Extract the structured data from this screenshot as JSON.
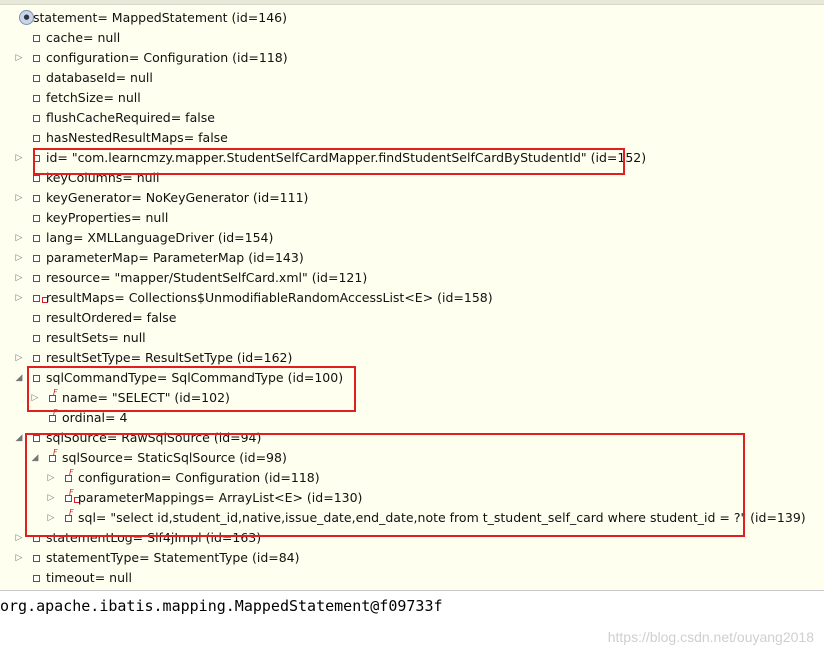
{
  "variables": [
    {
      "label": "statement= MappedStatement  (id=146)",
      "depth": 0,
      "twisty": "none",
      "icon": "gear-icon"
    },
    {
      "label": "cache= null",
      "depth": 1,
      "twisty": "none",
      "icon": "field-icon"
    },
    {
      "label": "configuration= Configuration  (id=118)",
      "depth": 1,
      "twisty": "collapsed",
      "icon": "field-icon"
    },
    {
      "label": "databaseId= null",
      "depth": 1,
      "twisty": "none",
      "icon": "field-icon"
    },
    {
      "label": "fetchSize= null",
      "depth": 1,
      "twisty": "none",
      "icon": "field-icon"
    },
    {
      "label": "flushCacheRequired= false",
      "depth": 1,
      "twisty": "none",
      "icon": "field-icon"
    },
    {
      "label": "hasNestedResultMaps= false",
      "depth": 1,
      "twisty": "none",
      "icon": "field-icon"
    },
    {
      "label": "id= \"com.learncmzy.mapper.StudentSelfCardMapper.findStudentSelfCardByStudentId\" (id=152)",
      "depth": 1,
      "twisty": "collapsed",
      "icon": "field-icon"
    },
    {
      "label": "keyColumns= null",
      "depth": 1,
      "twisty": "none",
      "icon": "field-icon"
    },
    {
      "label": "keyGenerator= NoKeyGenerator  (id=111)",
      "depth": 1,
      "twisty": "collapsed",
      "icon": "field-icon"
    },
    {
      "label": "keyProperties= null",
      "depth": 1,
      "twisty": "none",
      "icon": "field-icon"
    },
    {
      "label": "lang= XMLLanguageDriver  (id=154)",
      "depth": 1,
      "twisty": "collapsed",
      "icon": "field-icon"
    },
    {
      "label": "parameterMap= ParameterMap  (id=143)",
      "depth": 1,
      "twisty": "collapsed",
      "icon": "field-icon"
    },
    {
      "label": "resource= \"mapper/StudentSelfCard.xml\" (id=121)",
      "depth": 1,
      "twisty": "collapsed",
      "icon": "field-icon"
    },
    {
      "label": "resultMaps= Collections$UnmodifiableRandomAccessList<E>  (id=158)",
      "depth": 1,
      "twisty": "collapsed",
      "icon": "collection-field-icon"
    },
    {
      "label": "resultOrdered= false",
      "depth": 1,
      "twisty": "none",
      "icon": "field-icon"
    },
    {
      "label": "resultSets= null",
      "depth": 1,
      "twisty": "none",
      "icon": "field-icon"
    },
    {
      "label": "resultSetType= ResultSetType  (id=162)",
      "depth": 1,
      "twisty": "collapsed",
      "icon": "field-icon"
    },
    {
      "label": "sqlCommandType= SqlCommandType  (id=100)",
      "depth": 1,
      "twisty": "expanded",
      "icon": "field-icon"
    },
    {
      "label": "name= \"SELECT\" (id=102)",
      "depth": 2,
      "twisty": "collapsed",
      "icon": "final-field-icon"
    },
    {
      "label": "ordinal= 4",
      "depth": 2,
      "twisty": "none",
      "icon": "final-field-icon"
    },
    {
      "label": "sqlSource= RawSqlSource  (id=94)",
      "depth": 1,
      "twisty": "expanded",
      "icon": "field-icon"
    },
    {
      "label": "sqlSource= StaticSqlSource  (id=98)",
      "depth": 2,
      "twisty": "expanded",
      "icon": "final-field-icon"
    },
    {
      "label": "configuration= Configuration  (id=118)",
      "depth": 3,
      "twisty": "collapsed",
      "icon": "final-field-icon"
    },
    {
      "label": "parameterMappings= ArrayList<E>  (id=130)",
      "depth": 3,
      "twisty": "collapsed",
      "icon": "final-collection-field-icon"
    },
    {
      "label": "sql= \"select id,student_id,native,issue_date,end_date,note from t_student_self_card where student_id = ?\" (id=139)",
      "depth": 3,
      "twisty": "collapsed",
      "icon": "final-field-icon"
    },
    {
      "label": "statementLog= Slf4jImpl  (id=163)",
      "depth": 1,
      "twisty": "collapsed",
      "icon": "field-icon"
    },
    {
      "label": "statementType= StatementType  (id=84)",
      "depth": 1,
      "twisty": "collapsed",
      "icon": "field-icon"
    },
    {
      "label": "timeout= null",
      "depth": 1,
      "twisty": "none",
      "icon": "field-icon"
    }
  ],
  "detail": {
    "text": "org.apache.ibatis.mapping.MappedStatement@f09733f"
  },
  "watermark": "https://blog.csdn.net/ouyang2018",
  "colors": {
    "highlight": "#e02020",
    "field_icon": "#d02030",
    "tree_bg": "#fffff0"
  }
}
